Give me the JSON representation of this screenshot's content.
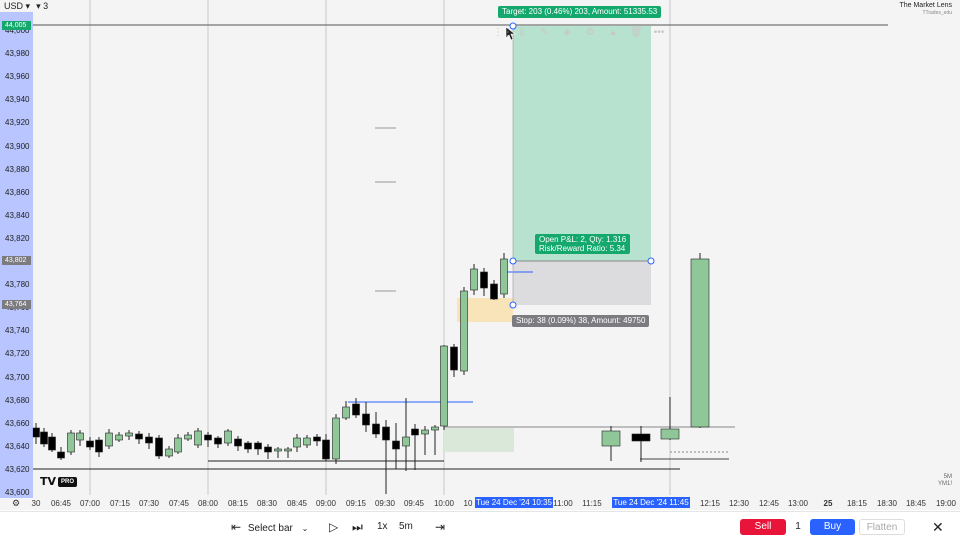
{
  "header": {
    "currency": "USD",
    "currency_caret": "▾",
    "layout_count_caret": "▾",
    "layout_count": "3",
    "brand_name": "The Market Lens",
    "brand_sub": "TTrades_edu"
  },
  "price_axis": {
    "ticks": [
      "44,000",
      "43,980",
      "43,960",
      "43,940",
      "43,920",
      "43,900",
      "43,880",
      "43,860",
      "43,840",
      "43,820",
      "43,800",
      "43,780",
      "43,760",
      "43,740",
      "43,720",
      "43,700",
      "43,680",
      "43,660",
      "43,640",
      "43,620",
      "43,600"
    ],
    "current_price_tag": "44,005",
    "price_tag_mid": "43,802",
    "price_tag_low": "43,764"
  },
  "time_axis": {
    "ticks": [
      "30",
      "06:45",
      "07:00",
      "07:15",
      "07:30",
      "07:45",
      "08:00",
      "08:15",
      "08:30",
      "08:45",
      "09:00",
      "09:15",
      "09:30",
      "09:45",
      "10:00",
      "10",
      "11:00",
      "11:15",
      "12:15",
      "12:30",
      "12:45",
      "13:00",
      "25",
      "18:15",
      "18:30",
      "18:45",
      "19:00"
    ],
    "highlight_start": "Tue 24 Dec '24   10:35",
    "highlight_end": "Tue 24 Dec '24   11:45"
  },
  "position_tool": {
    "target_label": "Target: 203 (0.46%) 203, Amount: 51335.53",
    "open_pnl_label": "Open P&L: 2, Qty: 1.316",
    "rr_label": "Risk/Reward Ratio: 5.34",
    "stop_label": "Stop: 38 (0.09%) 38, Amount: 49750"
  },
  "watermark": {
    "logo_text": "TV",
    "pro_badge": "PRO",
    "symbol_interval": "5M",
    "symbol": "YM1!"
  },
  "bottom_bar": {
    "select_bar_label": "Select bar",
    "speed_label": "1x",
    "interval_label": "5m",
    "sell_label": "Sell",
    "quantity": "1",
    "buy_label": "Buy",
    "flatten_label": "Flatten"
  },
  "colors": {
    "up_candle": "#8fc799",
    "down_candle": "#000000",
    "target_zone": "#b7e2d0",
    "stop_zone": "#dcdcdf",
    "label_green": "#14a86d",
    "label_grey": "#7b7b80",
    "axis_highlight": "#2962ff",
    "price_axis_band": "#adbcff",
    "sell_red": "#e8143a"
  },
  "icons": [
    "settings-gear-icon",
    "select-bar-icon",
    "play-icon",
    "step-forward-icon",
    "end-replay-icon",
    "close-icon"
  ],
  "chart_data": {
    "type": "candlestick",
    "instrument": "YM1!",
    "timeframe": "5M",
    "ylim": [
      43600,
      44005
    ],
    "time_range": [
      "06:45",
      "19:00"
    ],
    "position": {
      "target_price": 44005,
      "entry_price": 43802,
      "stop_price": 43764,
      "start_time": "10:35",
      "end_time": "11:45"
    }
  }
}
